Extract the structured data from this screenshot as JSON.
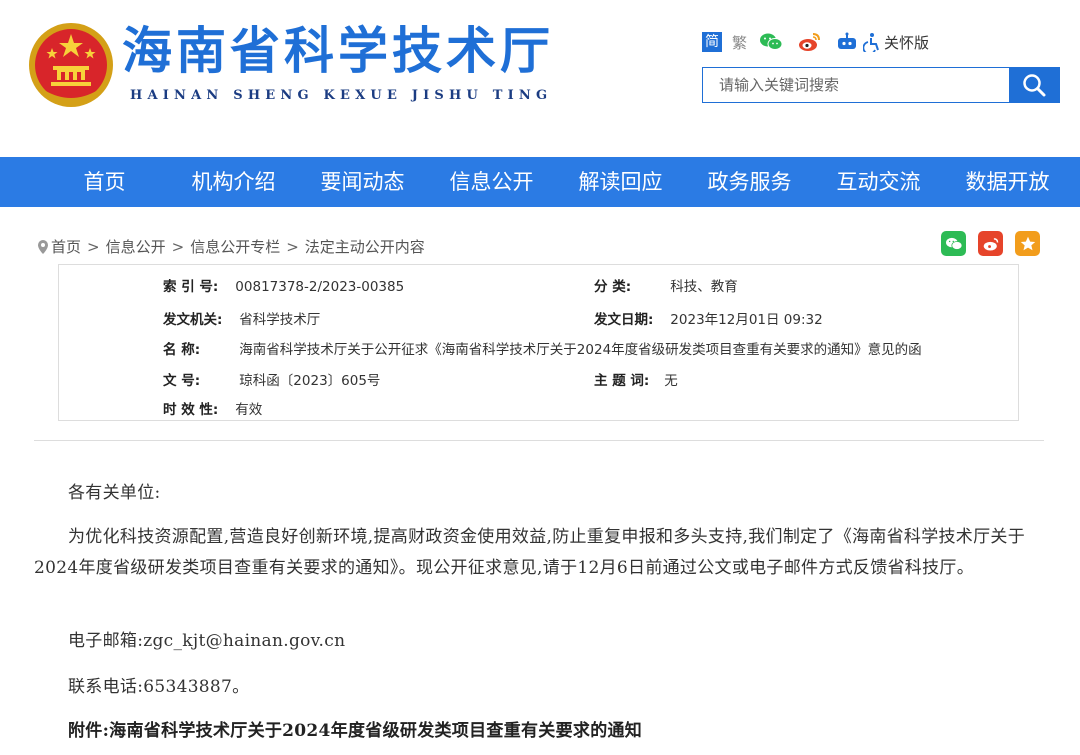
{
  "header": {
    "title": "海南省科学技术厅",
    "pinyin": "HAINAN SHENG KEXUE JISHU TING",
    "tools": {
      "simplified": "简",
      "traditional": "繁",
      "care_mode": "关怀版"
    },
    "search": {
      "placeholder": "请输入关键词搜索"
    }
  },
  "nav": {
    "items": [
      {
        "label": "首页"
      },
      {
        "label": "机构介绍"
      },
      {
        "label": "要闻动态"
      },
      {
        "label": "信息公开"
      },
      {
        "label": "解读回应"
      },
      {
        "label": "政务服务"
      },
      {
        "label": "互动交流"
      },
      {
        "label": "数据开放"
      }
    ]
  },
  "breadcrumb": {
    "items": [
      "首页",
      "信息公开",
      "信息公开专栏",
      "法定主动公开内容"
    ],
    "separator": ">"
  },
  "info": {
    "index_label": "索 引 号:",
    "index_value": "00817378-2/2023-00385",
    "category_label": "分 类:",
    "category_value": "科技、教育",
    "issuer_label": "发文机关:",
    "issuer_value": "省科学技术厅",
    "date_label": "发文日期:",
    "date_value": "2023年12月01日 09:32",
    "name_label": "名 称:",
    "name_value": "海南省科学技术厅关于公开征求《海南省科学技术厅关于2024年度省级研发类项目查重有关要求的通知》意见的函",
    "docno_label": "文 号:",
    "docno_value": "琼科函〔2023〕605号",
    "subject_label": "主 题 词:",
    "subject_value": "无",
    "validity_label": "时 效 性:",
    "validity_value": "有效"
  },
  "article": {
    "salutation": "各有关单位:",
    "body": "为优化科技资源配置,营造良好创新环境,提高财政资金使用效益,防止重复申报和多头支持,我们制定了《海南省科学技术厅关于2024年度省级研发类项目查重有关要求的通知》。现公开征求意见,请于12月6日前通过公文或电子邮件方式反馈省科技厅。",
    "email": "电子邮箱:zgc_kjt@hainan.gov.cn",
    "phone": "联系电话:65343887。",
    "attachment": "附件:海南省科学技术厅关于2024年度省级研发类项目查重有关要求的通知"
  },
  "colors": {
    "brand_blue": "#1f6fd6",
    "nav_blue": "#2b7be4",
    "wechat_green": "#2dbb55",
    "weibo_red": "#e6442a",
    "favorite_orange": "#f29d1c"
  }
}
